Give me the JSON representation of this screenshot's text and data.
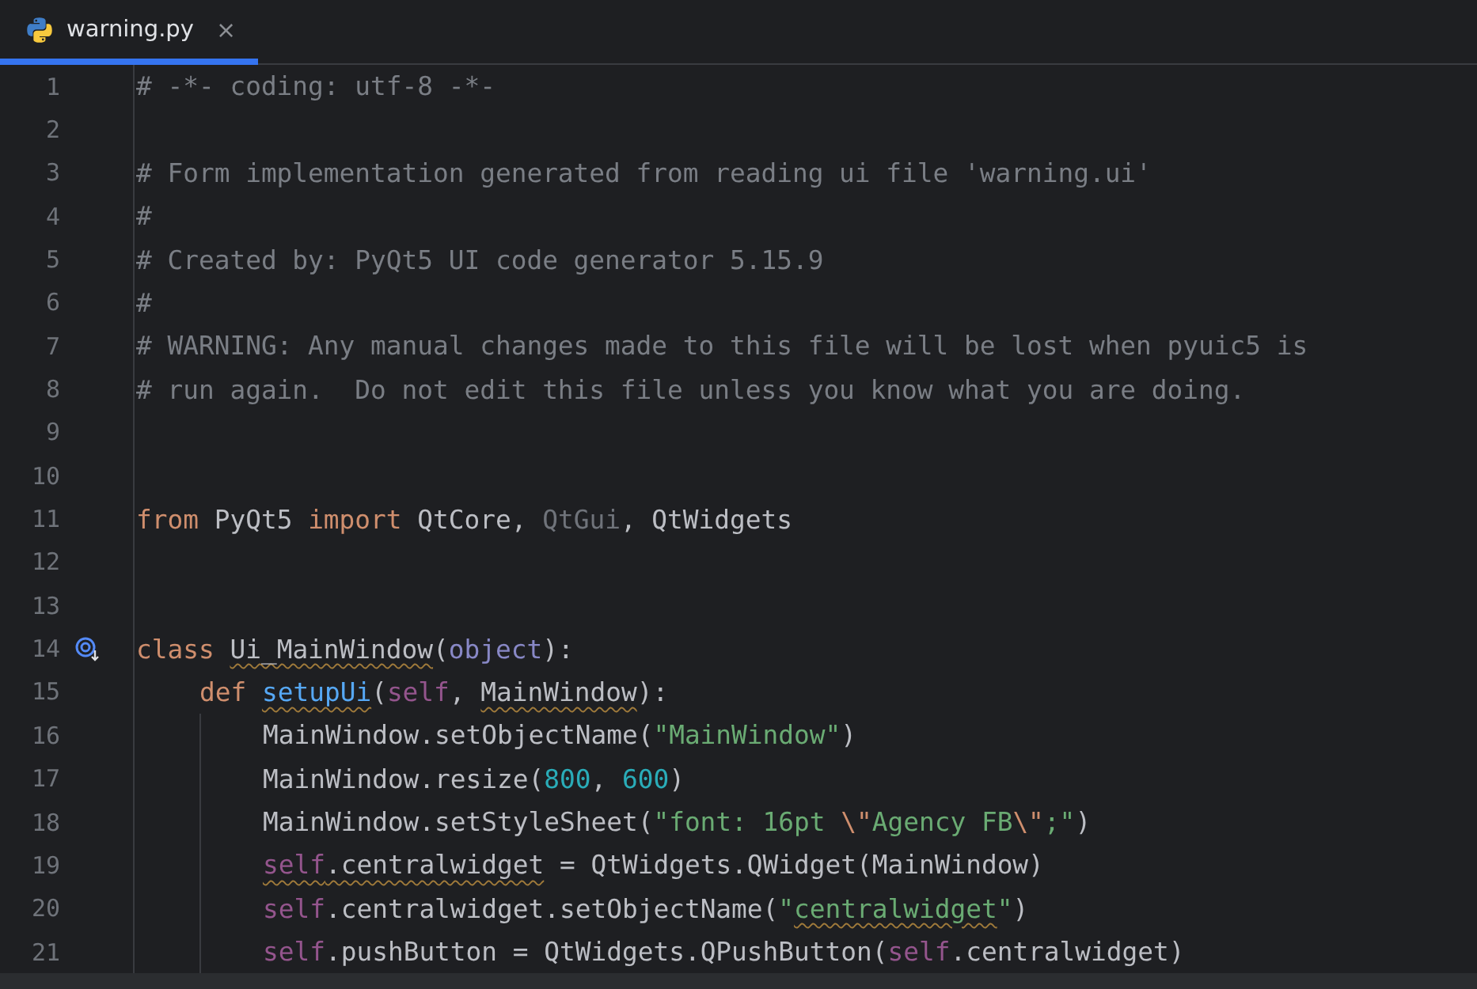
{
  "tabs": [
    {
      "label": "warning.py",
      "selected": true,
      "close": "×"
    }
  ],
  "lines": [
    {
      "number": "1",
      "tokens": [
        {
          "kind": "comment",
          "text": "# -*- coding: utf-8 -*-"
        }
      ]
    },
    {
      "number": "2"
    },
    {
      "number": "3",
      "tokens": [
        {
          "kind": "comment",
          "text": "# Form implementation generated from reading ui file 'warning.ui'"
        }
      ]
    },
    {
      "number": "4",
      "tokens": [
        {
          "kind": "comment",
          "text": "#"
        }
      ]
    },
    {
      "number": "5",
      "tokens": [
        {
          "kind": "comment",
          "text": "# Created by: PyQt5 UI code generator 5.15.9"
        }
      ]
    },
    {
      "number": "6",
      "tokens": [
        {
          "kind": "comment",
          "text": "#"
        }
      ]
    },
    {
      "number": "7",
      "tokens": [
        {
          "kind": "comment",
          "text": "# WARNING: Any manual changes made to this file will be lost when pyuic5 is"
        }
      ]
    },
    {
      "number": "8",
      "tokens": [
        {
          "kind": "comment",
          "text": "# run again.  Do not edit this file unless you know what you are doing."
        }
      ]
    },
    {
      "number": "9"
    },
    {
      "number": "10"
    },
    {
      "number": "11",
      "tokens": [
        {
          "kind": "keyword",
          "text": "from"
        },
        {
          "kind": "plain",
          "text": " PyQt5 "
        },
        {
          "kind": "keyword",
          "text": "import"
        },
        {
          "kind": "plain",
          "text": " QtCore, "
        },
        {
          "kind": "unused",
          "text": "QtGui"
        },
        {
          "kind": "plain",
          "text": ", QtWidgets"
        }
      ]
    },
    {
      "number": "12"
    },
    {
      "number": "13"
    },
    {
      "number": "14",
      "gutter_icon": true,
      "tokens": [
        {
          "kind": "keyword",
          "text": "class "
        },
        {
          "kind": "plain",
          "text": "Ui_MainWindow",
          "squiggle": true
        },
        {
          "kind": "plain",
          "text": "("
        },
        {
          "kind": "builtin",
          "text": "object"
        },
        {
          "kind": "plain",
          "text": "):"
        }
      ],
      "children": [
        {
          "number": "15",
          "tokens": [
            {
              "kind": "keyword",
              "text": "def "
            },
            {
              "kind": "function",
              "text": "setupUi",
              "squiggle": true
            },
            {
              "kind": "plain",
              "text": "("
            },
            {
              "kind": "self",
              "text": "self"
            },
            {
              "kind": "plain",
              "text": ", "
            },
            {
              "kind": "plain",
              "text": "MainWindow",
              "squiggle": true
            },
            {
              "kind": "plain",
              "text": "):"
            }
          ],
          "children": [
            {
              "number": "16",
              "tokens": [
                {
                  "kind": "plain",
                  "text": "MainWindow.setObjectName("
                },
                {
                  "kind": "string",
                  "text": "\"MainWindow\""
                },
                {
                  "kind": "plain",
                  "text": ")"
                }
              ]
            },
            {
              "number": "17",
              "tokens": [
                {
                  "kind": "plain",
                  "text": "MainWindow.resize("
                },
                {
                  "kind": "number",
                  "text": "800"
                },
                {
                  "kind": "plain",
                  "text": ", "
                },
                {
                  "kind": "number",
                  "text": "600"
                },
                {
                  "kind": "plain",
                  "text": ")"
                }
              ]
            },
            {
              "number": "18",
              "tokens": [
                {
                  "kind": "plain",
                  "text": "MainWindow.setStyleSheet("
                },
                {
                  "kind": "string",
                  "text": "\"font: 16pt "
                },
                {
                  "kind": "escape",
                  "text": "\\\""
                },
                {
                  "kind": "string",
                  "text": "Agency FB"
                },
                {
                  "kind": "escape",
                  "text": "\\\""
                },
                {
                  "kind": "string",
                  "text": ";\""
                },
                {
                  "kind": "plain",
                  "text": ")"
                }
              ]
            },
            {
              "number": "19",
              "tokens": [
                {
                  "kind": "self",
                  "text": "self",
                  "squiggle": true
                },
                {
                  "kind": "plain",
                  "text": ".centralwidget",
                  "squiggle": true
                },
                {
                  "kind": "plain",
                  "text": " = QtWidgets.QWidget(MainWindow)"
                }
              ]
            },
            {
              "number": "20",
              "tokens": [
                {
                  "kind": "self",
                  "text": "self"
                },
                {
                  "kind": "plain",
                  "text": ".centralwidget.setObjectName("
                },
                {
                  "kind": "string",
                  "text": "\""
                },
                {
                  "kind": "string",
                  "text": "centralwidget",
                  "squiggle": true
                },
                {
                  "kind": "string",
                  "text": "\""
                },
                {
                  "kind": "plain",
                  "text": ")"
                }
              ]
            },
            {
              "number": "21",
              "tokens": [
                {
                  "kind": "self",
                  "text": "self"
                },
                {
                  "kind": "plain",
                  "text": ".pushButton = QtWidgets.QPushButton("
                },
                {
                  "kind": "self",
                  "text": "self"
                },
                {
                  "kind": "plain",
                  "text": ".centralwidget)"
                }
              ]
            }
          ]
        }
      ]
    }
  ]
}
